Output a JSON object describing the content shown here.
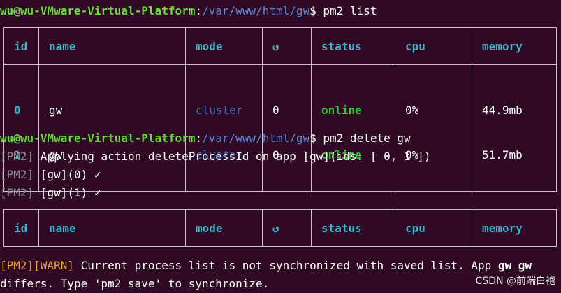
{
  "prompt1": {
    "user": "wu@wu-VMware-Virtual-Platform",
    "sep": ":",
    "path": "/var/www/html/gw",
    "dollar": "$",
    "cmd": " pm2 list"
  },
  "table1": {
    "headers": [
      "id",
      "name",
      "mode",
      "↺",
      "status",
      "cpu",
      "memory"
    ],
    "rows": [
      {
        "id": "0",
        "name": "gw",
        "mode": "cluster",
        "restarts": "0",
        "status": "online",
        "cpu": "0%",
        "memory": "44.9mb"
      },
      {
        "id": "1",
        "name": "gw",
        "mode": "cluster",
        "restarts": "0",
        "status": "online",
        "cpu": "0%",
        "memory": "51.7mb"
      }
    ]
  },
  "prompt2": {
    "user": "wu@wu-VMware-Virtual-Platform",
    "sep": ":",
    "path": "/var/www/html/gw",
    "dollar": "$",
    "cmd": " pm2 delete gw"
  },
  "log": [
    {
      "tag": "[PM2]",
      "text": " Applying action deleteProcessId on app [gw](ids: [ 0, 1 ])"
    },
    {
      "tag": "[PM2]",
      "text": " [gw](0) ✓"
    },
    {
      "tag": "[PM2]",
      "text": " [gw](1) ✓"
    }
  ],
  "table2": {
    "headers": [
      "id",
      "name",
      "mode",
      "↺",
      "status",
      "cpu",
      "memory"
    ]
  },
  "warning": {
    "tag": "[PM2][WARN]",
    "text1": " Current process list is not synchronized with saved list. App ",
    "app": "gw gw",
    "text2": "differs. Type 'pm2 save' to synchronize."
  },
  "watermark": "CSDN @前端白袍"
}
